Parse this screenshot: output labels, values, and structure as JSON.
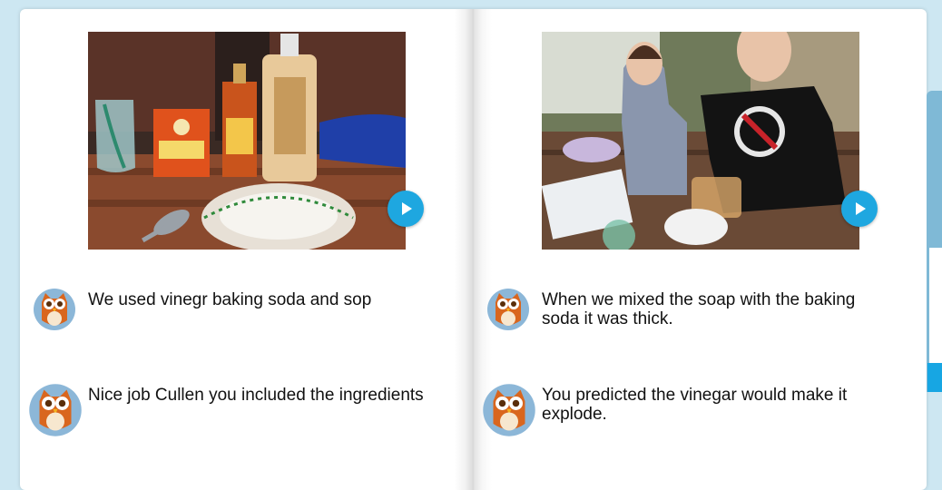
{
  "pages": [
    {
      "photo_icon": "photo-baking-ingredients",
      "play_icon": "play-icon",
      "entries": [
        {
          "avatar": "owl-avatar-icon",
          "text": "We used vinegr baking soda and sop"
        },
        {
          "avatar": "owl-avatar-icon",
          "text": "Nice job Cullen you included the ingredients"
        }
      ]
    },
    {
      "photo_icon": "photo-kids-experiment",
      "play_icon": "play-icon",
      "entries": [
        {
          "avatar": "owl-avatar-icon",
          "text": "When we mixed the soap with the baking soda it was thick."
        },
        {
          "avatar": "owl-avatar-icon",
          "text": "You predicted the vinegar would make it explode."
        }
      ]
    }
  ],
  "colors": {
    "background": "#cde7f2",
    "play_button": "#1ea7e0",
    "owl_body": "#d9661e",
    "owl_circle": "#8cb7d8"
  }
}
